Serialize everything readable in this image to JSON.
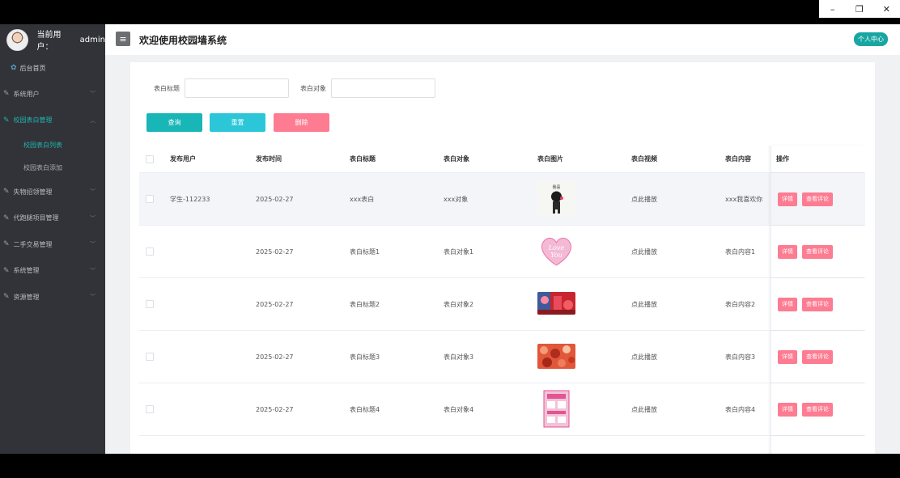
{
  "window": {
    "minimize": "–",
    "restore": "❐",
    "close": "✕"
  },
  "sidebar": {
    "user_label": "当前用户：",
    "user_name": "admin",
    "home": "后台首页",
    "items": [
      {
        "label": "系统用户",
        "active": false
      },
      {
        "label": "校园表白管理",
        "active": true,
        "sub": [
          {
            "label": "校园表白列表",
            "active": true
          },
          {
            "label": "校园表白添加",
            "active": false
          }
        ]
      },
      {
        "label": "失物招领管理",
        "active": false
      },
      {
        "label": "代跑腿项目管理",
        "active": false
      },
      {
        "label": "二手交易管理",
        "active": false
      },
      {
        "label": "系统管理",
        "active": false
      },
      {
        "label": "资源管理",
        "active": false
      }
    ]
  },
  "header": {
    "title": "欢迎使用校园墙系统",
    "profile": "个人中心",
    "menu_icon": "≡"
  },
  "search": {
    "title_label": "表白标题",
    "target_label": "表白对象"
  },
  "buttons": {
    "query": "查询",
    "reset": "重置",
    "delete": "删除"
  },
  "table": {
    "headers": {
      "user": "发布用户",
      "time": "发布时间",
      "title": "表白标题",
      "target": "表白对象",
      "image": "表白图片",
      "video": "表白视频",
      "content": "表白内容",
      "op": "操作"
    },
    "ops": {
      "detail": "详情",
      "comments": "查看评论"
    },
    "rows": [
      {
        "user": "学生-112233",
        "time": "2025-02-27",
        "title": "xxx表白",
        "target": "xxx对象",
        "video": "点此播放",
        "content": "xxx我喜欢你",
        "img": "cartoon"
      },
      {
        "user": "",
        "time": "2025-02-27",
        "title": "表白标题1",
        "target": "表白对象1",
        "video": "点此播放",
        "content": "表白内容1",
        "img": "heart"
      },
      {
        "user": "",
        "time": "2025-02-27",
        "title": "表白标题2",
        "target": "表白对象2",
        "video": "点此播放",
        "content": "表白内容2",
        "img": "red1"
      },
      {
        "user": "",
        "time": "2025-02-27",
        "title": "表白标题3",
        "target": "表白对象3",
        "video": "点此播放",
        "content": "表白内容3",
        "img": "red2"
      },
      {
        "user": "",
        "time": "2025-02-27",
        "title": "表白标题4",
        "target": "表白对象4",
        "video": "点此播放",
        "content": "表白内容4",
        "img": "poster"
      },
      {
        "user": "",
        "time": "",
        "title": "",
        "target": "",
        "video": "",
        "content": "",
        "img": "blue"
      }
    ]
  },
  "colors": {
    "sidebar_bg": "#323338",
    "accent": "#1fb5b1",
    "danger": "#fd7c92"
  }
}
